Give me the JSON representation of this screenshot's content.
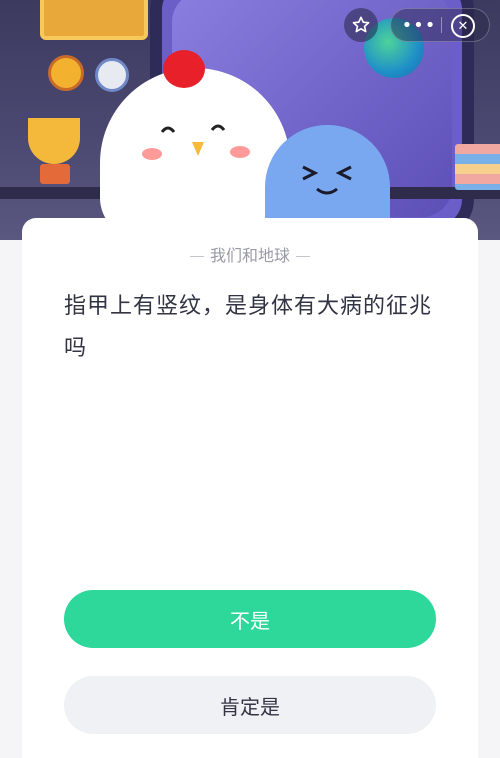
{
  "header": {
    "actions": {
      "favorite_icon": "star-icon",
      "more_glyph": "•••",
      "close_glyph": "✕"
    }
  },
  "quiz": {
    "topic": "我们和地球",
    "question": "指甲上有竖纹，是身体有大病的征兆吗",
    "options": [
      {
        "label": "不是"
      },
      {
        "label": "肯定是"
      }
    ]
  },
  "colors": {
    "primary_button": "#2ed89a",
    "secondary_button": "#f0f1f5",
    "banner_background": "#3c3a5e"
  }
}
